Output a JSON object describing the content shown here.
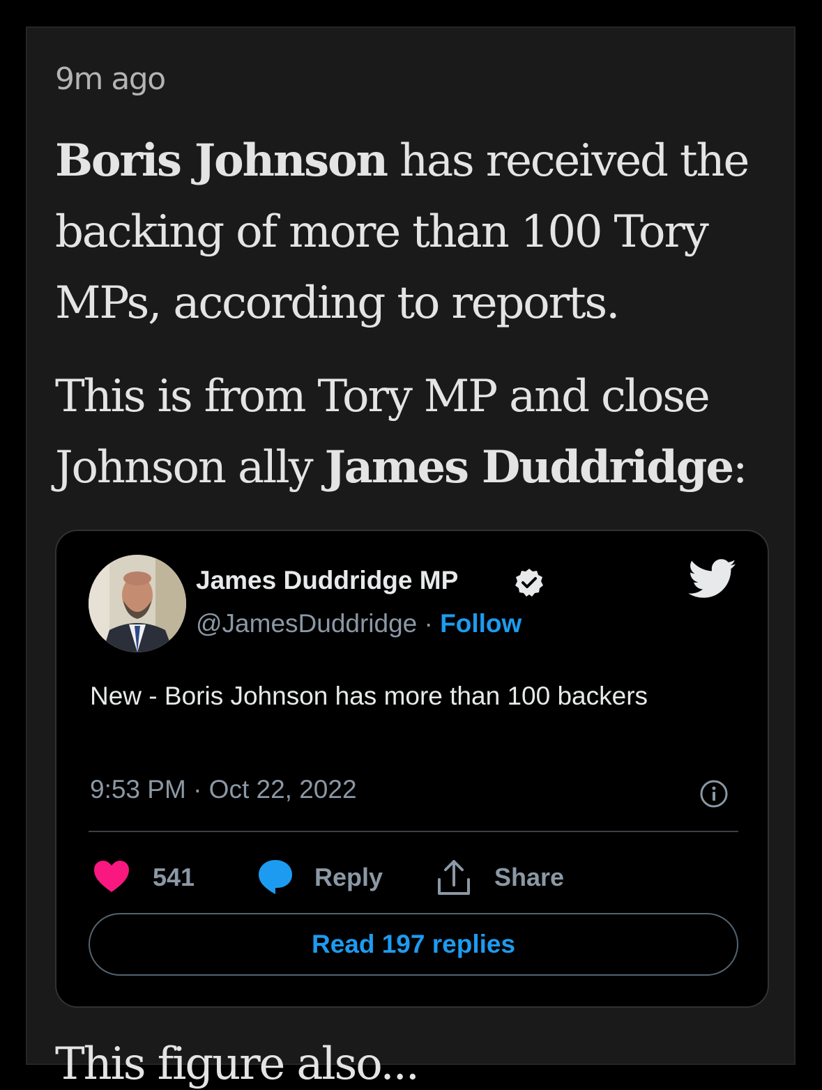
{
  "live_blog": {
    "timestamp": "9m ago",
    "para1": {
      "bold": "Boris Johnson",
      "rest": " has received the backing of more than 100 Tory MPs, according to reports."
    },
    "para2": {
      "lead": "This is from Tory MP and close Johnson ally ",
      "bold": "James Duddridge",
      "tail": ":"
    },
    "next_para_fragment": "This figure also..."
  },
  "tweet": {
    "author_name": "James Duddridge MP",
    "handle": "@JamesDuddridge",
    "separator": " · ",
    "follow_label": "Follow",
    "text": "New - Boris Johnson has more than 100 backers",
    "time": "9:53 PM · Oct 22, 2022",
    "likes": "541",
    "reply_label": "Reply",
    "share_label": "Share",
    "read_replies_label": "Read 197 replies",
    "icons": [
      "verified-badge-icon",
      "twitter-bird-icon",
      "info-icon",
      "heart-icon",
      "reply-bubble-icon",
      "share-icon"
    ]
  },
  "colors": {
    "background": "#000000",
    "card": "#1a1a1a",
    "accent_blue": "#1d9bf0",
    "like_pink": "#f91880"
  }
}
